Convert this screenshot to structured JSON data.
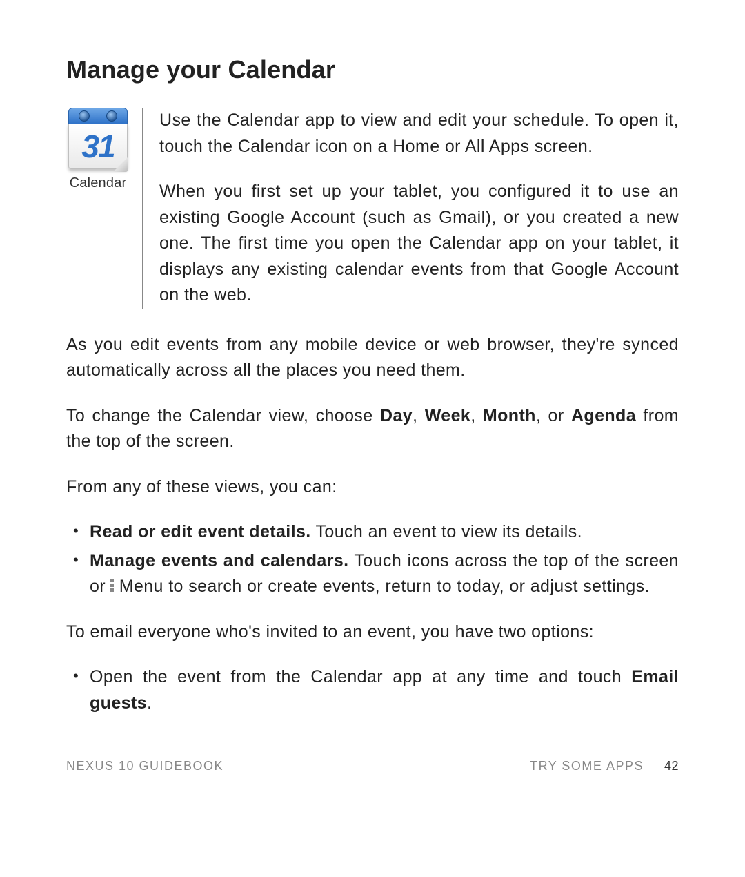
{
  "title": "Manage your Calendar",
  "icon": {
    "day_number": "31",
    "label": "Calendar"
  },
  "intro": {
    "p1": "Use the Calendar app to view and edit your schedule. To open it, touch the Calendar icon on a Home or All Apps screen.",
    "p2": "When you first set up your tablet, you configured it to use an existing Google Account (such as Gmail), or you created a new one. The first time you open the Calendar app on your tablet, it displays any existing calendar events from that Google Account on the web."
  },
  "body": {
    "p3": "As you edit events from any mobile device or web browser, they're synced automatically across all the places you need them.",
    "p4_pre": "To change the Calendar view, choose ",
    "p4_b1": "Day",
    "p4_s1": ", ",
    "p4_b2": "Week",
    "p4_s2": ", ",
    "p4_b3": "Month",
    "p4_s3": ", or ",
    "p4_b4": "Agenda",
    "p4_post": " from the top of the screen.",
    "p5": "From any of these views, you can:",
    "li1_b": "Read or edit event details.",
    "li1_t": " Touch an event to view its details.",
    "li2_b": "Manage events and calendars.",
    "li2_t1": " Touch icons across the top of the screen or ",
    "li2_t2": " Menu to search or create events, return to today, or adjust settings.",
    "p6": "To email everyone who's invited to an event, you have two options:",
    "li3_t": "Open the event from the Calendar app at any time and touch ",
    "li3_b": "Email guests",
    "li3_d": "."
  },
  "footer": {
    "left": "NEXUS 10 GUIDEBOOK",
    "section": "TRY SOME APPS",
    "page": "42"
  }
}
